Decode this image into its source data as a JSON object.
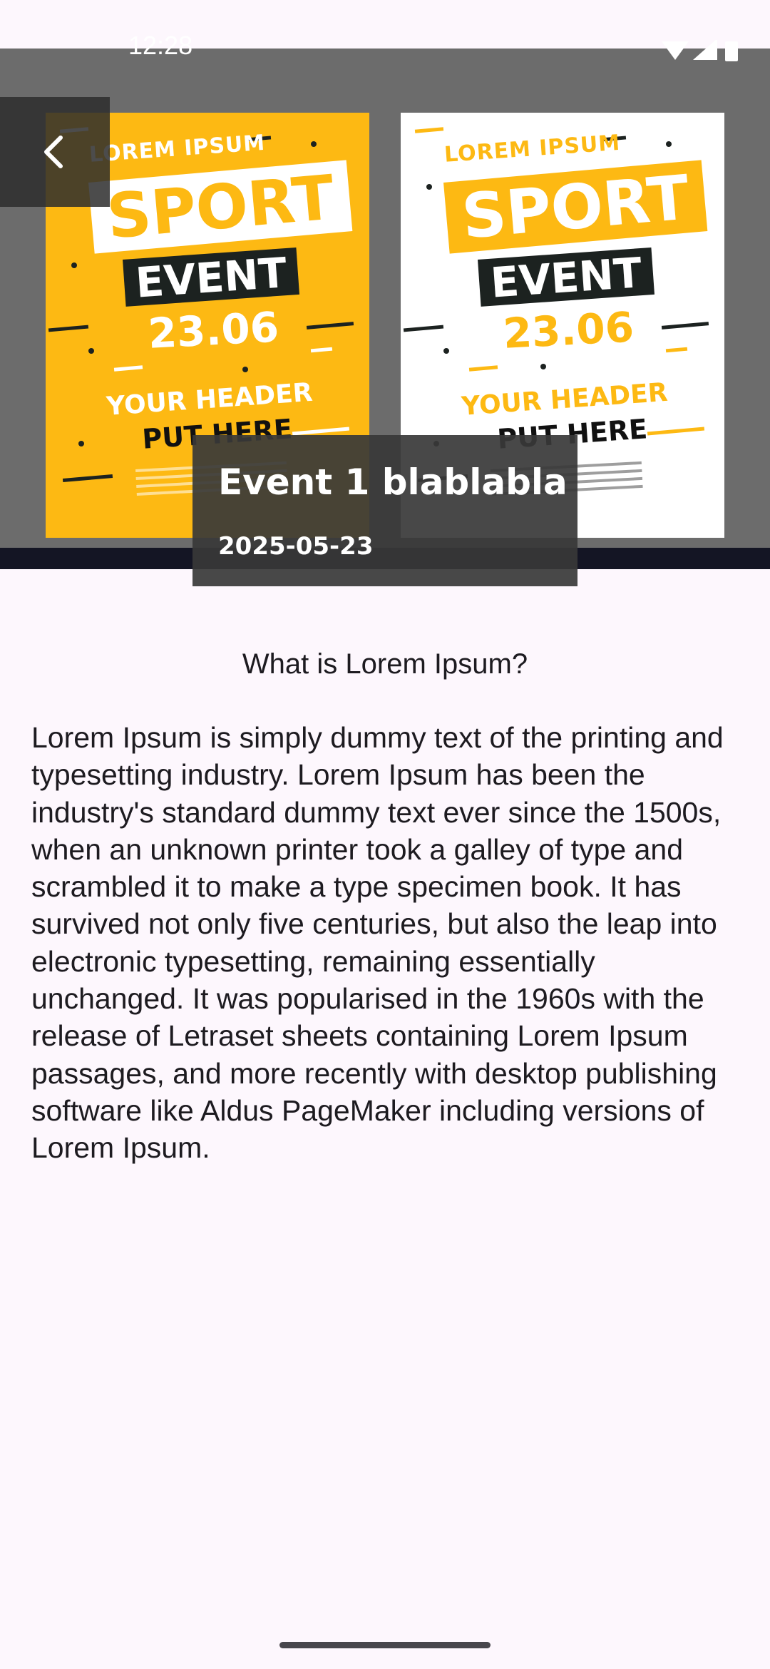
{
  "status_bar": {
    "time": "12:28",
    "icons": [
      "wifi-icon",
      "signal-icon",
      "battery-icon"
    ]
  },
  "hero": {
    "posters": [
      {
        "style": "yellow",
        "lorem": "LOREM IPSUM",
        "sport": "SPORT",
        "event": "EVENT",
        "date": "23.06",
        "header_line1": "YOUR HEADER",
        "header_line2": "PUT HERE"
      },
      {
        "style": "white",
        "lorem": "LOREM IPSUM",
        "sport": "SPORT",
        "event": "EVENT",
        "date": "23.06",
        "header_line1": "YOUR HEADER",
        "header_line2": "PUT HERE"
      }
    ]
  },
  "back_icon": "chevron-left-icon",
  "event": {
    "title": "Event 1 blablabla",
    "date": "2025-05-23"
  },
  "content": {
    "heading": "What is Lorem Ipsum?",
    "body": "Lorem Ipsum is simply dummy text of the printing and typesetting industry. Lorem Ipsum has been the industry's standard dummy text ever since the 1500s, when an unknown printer took a galley of type and scrambled it to make a type specimen book. It has survived not only five centuries, but also the leap into electronic typesetting, remaining essentially unchanged. It was popularised in the 1960s with the release of Letraset sheets containing Lorem Ipsum passages, and more recently with desktop publishing software like Aldus PageMaker including versions of Lorem Ipsum."
  },
  "colors": {
    "accent_yellow": "#fdb913",
    "background": "#fdf7fd",
    "overlay": "#383838",
    "text": "#1d1b20"
  }
}
